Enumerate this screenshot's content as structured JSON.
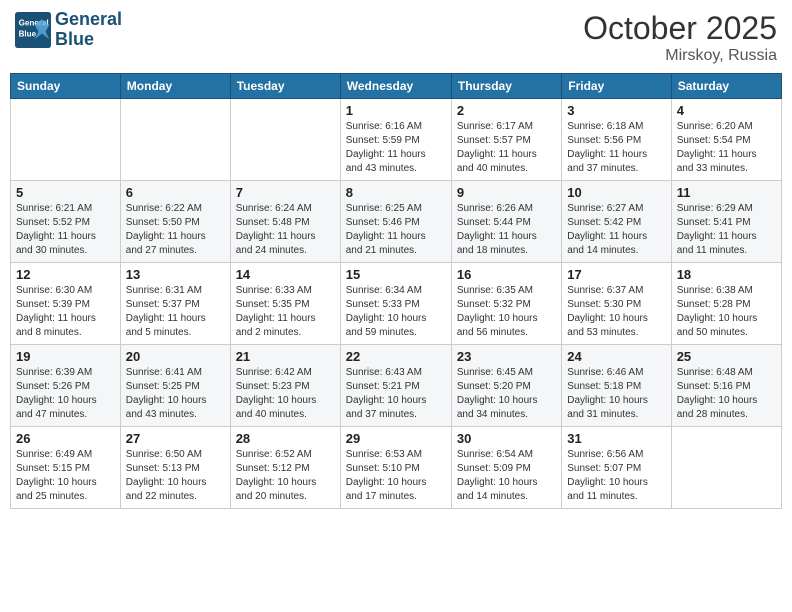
{
  "header": {
    "logo_line1": "General",
    "logo_line2": "Blue",
    "month": "October 2025",
    "location": "Mirskoy, Russia"
  },
  "weekdays": [
    "Sunday",
    "Monday",
    "Tuesday",
    "Wednesday",
    "Thursday",
    "Friday",
    "Saturday"
  ],
  "weeks": [
    [
      {
        "day": "",
        "info": ""
      },
      {
        "day": "",
        "info": ""
      },
      {
        "day": "",
        "info": ""
      },
      {
        "day": "1",
        "info": "Sunrise: 6:16 AM\nSunset: 5:59 PM\nDaylight: 11 hours\nand 43 minutes."
      },
      {
        "day": "2",
        "info": "Sunrise: 6:17 AM\nSunset: 5:57 PM\nDaylight: 11 hours\nand 40 minutes."
      },
      {
        "day": "3",
        "info": "Sunrise: 6:18 AM\nSunset: 5:56 PM\nDaylight: 11 hours\nand 37 minutes."
      },
      {
        "day": "4",
        "info": "Sunrise: 6:20 AM\nSunset: 5:54 PM\nDaylight: 11 hours\nand 33 minutes."
      }
    ],
    [
      {
        "day": "5",
        "info": "Sunrise: 6:21 AM\nSunset: 5:52 PM\nDaylight: 11 hours\nand 30 minutes."
      },
      {
        "day": "6",
        "info": "Sunrise: 6:22 AM\nSunset: 5:50 PM\nDaylight: 11 hours\nand 27 minutes."
      },
      {
        "day": "7",
        "info": "Sunrise: 6:24 AM\nSunset: 5:48 PM\nDaylight: 11 hours\nand 24 minutes."
      },
      {
        "day": "8",
        "info": "Sunrise: 6:25 AM\nSunset: 5:46 PM\nDaylight: 11 hours\nand 21 minutes."
      },
      {
        "day": "9",
        "info": "Sunrise: 6:26 AM\nSunset: 5:44 PM\nDaylight: 11 hours\nand 18 minutes."
      },
      {
        "day": "10",
        "info": "Sunrise: 6:27 AM\nSunset: 5:42 PM\nDaylight: 11 hours\nand 14 minutes."
      },
      {
        "day": "11",
        "info": "Sunrise: 6:29 AM\nSunset: 5:41 PM\nDaylight: 11 hours\nand 11 minutes."
      }
    ],
    [
      {
        "day": "12",
        "info": "Sunrise: 6:30 AM\nSunset: 5:39 PM\nDaylight: 11 hours\nand 8 minutes."
      },
      {
        "day": "13",
        "info": "Sunrise: 6:31 AM\nSunset: 5:37 PM\nDaylight: 11 hours\nand 5 minutes."
      },
      {
        "day": "14",
        "info": "Sunrise: 6:33 AM\nSunset: 5:35 PM\nDaylight: 11 hours\nand 2 minutes."
      },
      {
        "day": "15",
        "info": "Sunrise: 6:34 AM\nSunset: 5:33 PM\nDaylight: 10 hours\nand 59 minutes."
      },
      {
        "day": "16",
        "info": "Sunrise: 6:35 AM\nSunset: 5:32 PM\nDaylight: 10 hours\nand 56 minutes."
      },
      {
        "day": "17",
        "info": "Sunrise: 6:37 AM\nSunset: 5:30 PM\nDaylight: 10 hours\nand 53 minutes."
      },
      {
        "day": "18",
        "info": "Sunrise: 6:38 AM\nSunset: 5:28 PM\nDaylight: 10 hours\nand 50 minutes."
      }
    ],
    [
      {
        "day": "19",
        "info": "Sunrise: 6:39 AM\nSunset: 5:26 PM\nDaylight: 10 hours\nand 47 minutes."
      },
      {
        "day": "20",
        "info": "Sunrise: 6:41 AM\nSunset: 5:25 PM\nDaylight: 10 hours\nand 43 minutes."
      },
      {
        "day": "21",
        "info": "Sunrise: 6:42 AM\nSunset: 5:23 PM\nDaylight: 10 hours\nand 40 minutes."
      },
      {
        "day": "22",
        "info": "Sunrise: 6:43 AM\nSunset: 5:21 PM\nDaylight: 10 hours\nand 37 minutes."
      },
      {
        "day": "23",
        "info": "Sunrise: 6:45 AM\nSunset: 5:20 PM\nDaylight: 10 hours\nand 34 minutes."
      },
      {
        "day": "24",
        "info": "Sunrise: 6:46 AM\nSunset: 5:18 PM\nDaylight: 10 hours\nand 31 minutes."
      },
      {
        "day": "25",
        "info": "Sunrise: 6:48 AM\nSunset: 5:16 PM\nDaylight: 10 hours\nand 28 minutes."
      }
    ],
    [
      {
        "day": "26",
        "info": "Sunrise: 6:49 AM\nSunset: 5:15 PM\nDaylight: 10 hours\nand 25 minutes."
      },
      {
        "day": "27",
        "info": "Sunrise: 6:50 AM\nSunset: 5:13 PM\nDaylight: 10 hours\nand 22 minutes."
      },
      {
        "day": "28",
        "info": "Sunrise: 6:52 AM\nSunset: 5:12 PM\nDaylight: 10 hours\nand 20 minutes."
      },
      {
        "day": "29",
        "info": "Sunrise: 6:53 AM\nSunset: 5:10 PM\nDaylight: 10 hours\nand 17 minutes."
      },
      {
        "day": "30",
        "info": "Sunrise: 6:54 AM\nSunset: 5:09 PM\nDaylight: 10 hours\nand 14 minutes."
      },
      {
        "day": "31",
        "info": "Sunrise: 6:56 AM\nSunset: 5:07 PM\nDaylight: 10 hours\nand 11 minutes."
      },
      {
        "day": "",
        "info": ""
      }
    ]
  ]
}
